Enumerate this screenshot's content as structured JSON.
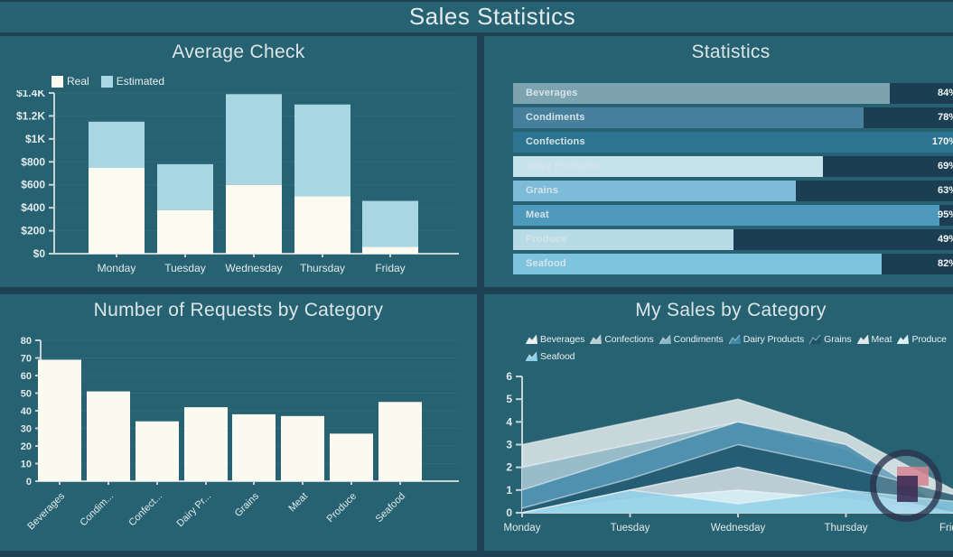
{
  "header": {
    "title": "Sales Statistics"
  },
  "chart_data": [
    {
      "id": "average-check",
      "type": "bar",
      "stacked": true,
      "title": "Average Check",
      "categories": [
        "Monday",
        "Tuesday",
        "Wednesday",
        "Thursday",
        "Friday"
      ],
      "series": [
        {
          "name": "Real",
          "color": "#fcfbf2",
          "values": [
            750,
            380,
            600,
            500,
            60
          ]
        },
        {
          "name": "Estimated",
          "color": "#a9d6e3",
          "values": [
            400,
            400,
            790,
            800,
            400
          ]
        }
      ],
      "ylim": [
        0,
        1400
      ],
      "ytick_step": 200,
      "ytick_labels": [
        "$0",
        "$200",
        "$400",
        "$600",
        "$800",
        "$1K",
        "$1.2K",
        "$1.4K"
      ],
      "legend_position": "top-left",
      "grid": true
    },
    {
      "id": "statistics",
      "type": "bar",
      "orientation": "horizontal",
      "title": "Statistics",
      "categories": [
        "Beverages",
        "Condiments",
        "Confections",
        "Dairy Products",
        "Grains",
        "Meat",
        "Produce",
        "Seafood"
      ],
      "values": [
        84,
        78,
        170,
        69,
        63,
        95,
        49,
        82
      ],
      "value_suffix": "%",
      "xlim": [
        0,
        100
      ],
      "bar_colors": [
        "#7da3b1",
        "#46809c",
        "#2b7492",
        "#c6e2eb",
        "#7cbcd8",
        "#4e9abc",
        "#b8dce6",
        "#7fc4df"
      ],
      "track_color": "#1b3e52"
    },
    {
      "id": "requests-by-category",
      "type": "bar",
      "title": "Number of Requests by Category",
      "categories": [
        "Beverages",
        "Condim...",
        "Confect...",
        "Dairy Pr...",
        "Grains",
        "Meat",
        "Produce",
        "Seafood"
      ],
      "values": [
        69,
        51,
        34,
        42,
        38,
        37,
        27,
        45
      ],
      "bar_color": "#fbfaf0",
      "ylim": [
        0,
        80
      ],
      "ytick_step": 10,
      "grid": true
    },
    {
      "id": "my-sales-by-category",
      "type": "area",
      "title": "My Sales by Category",
      "categories": [
        "Monday",
        "Tuesday",
        "Wednesday",
        "Thursday",
        "Friday"
      ],
      "ylim": [
        0,
        6
      ],
      "ytick_step": 1,
      "legend_position": "top",
      "series": [
        {
          "name": "Beverages",
          "color": "#edf1f1",
          "values": [
            3,
            4,
            5,
            3.5,
            1
          ]
        },
        {
          "name": "Confections",
          "color": "#b9cdd4",
          "values": [
            0,
            1,
            2,
            1,
            0
          ]
        },
        {
          "name": "Condiments",
          "color": "#8fb6c7",
          "values": [
            2,
            3,
            4,
            2.8,
            0.2
          ]
        },
        {
          "name": "Dairy Products",
          "color": "#3f88a8",
          "values": [
            1,
            2.5,
            4,
            3,
            0
          ]
        },
        {
          "name": "Grains",
          "color": "#1b5266",
          "values": [
            0.2,
            1.5,
            3,
            2,
            0.8
          ]
        },
        {
          "name": "Meat",
          "color": "#dfe7ea",
          "values": [
            0,
            1,
            2,
            1,
            0
          ]
        },
        {
          "name": "Produce",
          "color": "#d8f1f7",
          "values": [
            0,
            0.6,
            1,
            0.6,
            0
          ]
        },
        {
          "name": "Seafood",
          "color": "#8ed0e8",
          "values": [
            0,
            1,
            0.4,
            1,
            0.5
          ]
        }
      ],
      "draw_order": [
        "Beverages",
        "Condiments",
        "Dairy Products",
        "Grains",
        "Meat",
        "Confections",
        "Produce",
        "Seafood"
      ]
    }
  ],
  "overlay_icon": {
    "name": "magnifier-flag-icon",
    "ring_color": "#1c243e",
    "flag_pink": "#d58290",
    "flag_purple": "#3e2f57"
  }
}
